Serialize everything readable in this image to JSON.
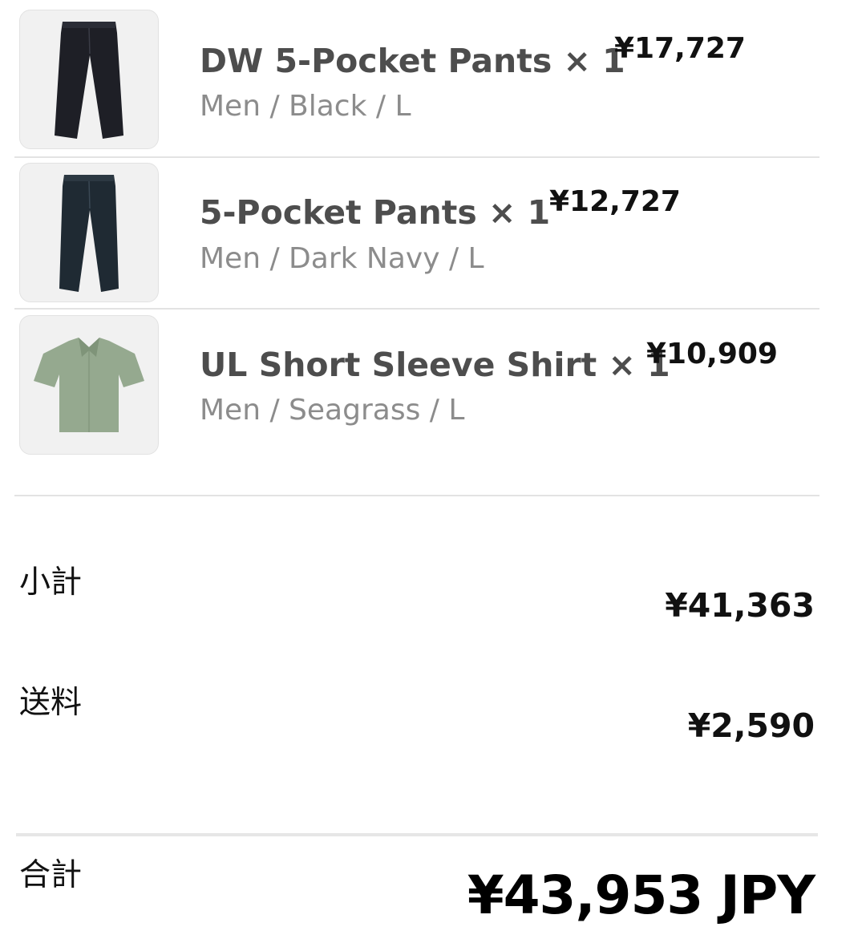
{
  "items": [
    {
      "name": "DW 5-Pocket Pants × 1",
      "variant": "Men / Black / L",
      "price": "¥17,727",
      "image_icon": "black-pants-image",
      "garment_color": "#1e1f26"
    },
    {
      "name": "5-Pocket Pants × 1",
      "variant": "Men / Dark Navy / L",
      "price": "¥12,727",
      "image_icon": "navy-pants-image",
      "garment_color": "#1f2a33"
    },
    {
      "name": "UL Short Sleeve Shirt × 1",
      "variant": "Men / Seagrass / L",
      "price": "¥10,909",
      "image_icon": "green-shirt-image",
      "garment_color": "#95a98f"
    }
  ],
  "summary": {
    "subtotal_label": "小計",
    "subtotal_value": "¥41,363",
    "shipping_label": "送料",
    "shipping_value": "¥2,590",
    "total_label": "合計",
    "total_value": "¥43,953 JPY"
  }
}
